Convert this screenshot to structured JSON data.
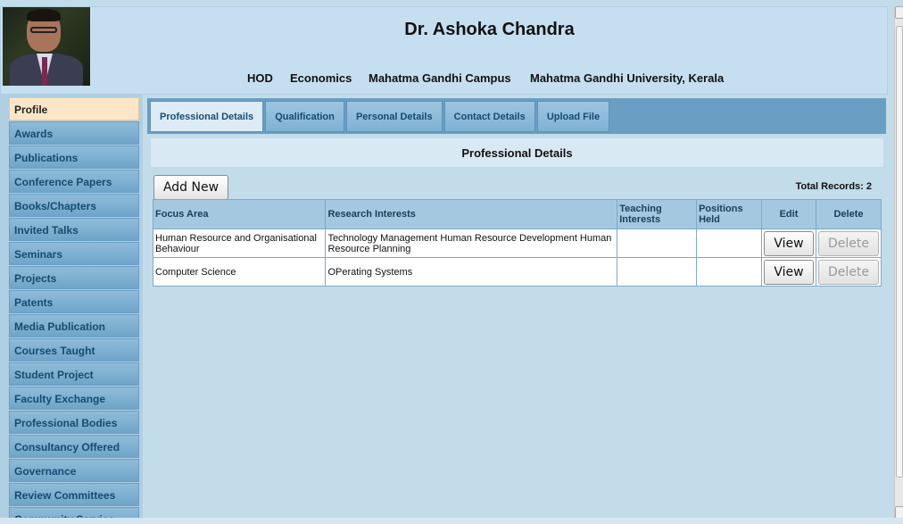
{
  "header": {
    "name": "Dr. Ashoka Chandra",
    "designation": "HOD",
    "department": "Economics",
    "campus": "Mahatma Gandhi Campus",
    "university": "Mahatma Gandhi University, Kerala"
  },
  "sidebar": {
    "items": [
      {
        "label": "Profile",
        "active": true
      },
      {
        "label": "Awards"
      },
      {
        "label": "Publications"
      },
      {
        "label": "Conference Papers"
      },
      {
        "label": "Books/Chapters"
      },
      {
        "label": "Invited Talks"
      },
      {
        "label": "Seminars"
      },
      {
        "label": "Projects"
      },
      {
        "label": "Patents"
      },
      {
        "label": "Media Publication"
      },
      {
        "label": "Courses Taught"
      },
      {
        "label": "Student Project"
      },
      {
        "label": "Faculty Exchange"
      },
      {
        "label": "Professional Bodies"
      },
      {
        "label": "Consultancy Offered"
      },
      {
        "label": "Governance"
      },
      {
        "label": "Review Committees"
      },
      {
        "label": "Community Service"
      }
    ]
  },
  "tabs": [
    {
      "label": "Professional Details",
      "active": true
    },
    {
      "label": "Qualification"
    },
    {
      "label": "Personal Details"
    },
    {
      "label": "Contact Details"
    },
    {
      "label": "Upload File"
    }
  ],
  "panel": {
    "title": "Professional Details",
    "add_label": "Add New",
    "total_label": "Total Records: 2"
  },
  "table": {
    "columns": [
      "Focus Area",
      "Research Interests",
      "Teaching Interests",
      "Positions Held",
      "Edit",
      "Delete"
    ],
    "rows": [
      {
        "focus_area": "Human Resource and Organisational Behaviour",
        "research_interests": "Technology Management Human Resource Development Human Resource Planning",
        "teaching_interests": "",
        "positions_held": "",
        "view_label": "View",
        "delete_label": "Delete"
      },
      {
        "focus_area": "Computer Science",
        "research_interests": "OPerating Systems",
        "teaching_interests": "",
        "positions_held": "",
        "view_label": "View",
        "delete_label": "Delete"
      }
    ]
  },
  "colors": {
    "background": "#c3dcea",
    "tab_bar": "#6a9ec2",
    "sidebar_item": "#7fb1d3",
    "active_item": "#fde6c8",
    "header": "#c6dff0"
  }
}
